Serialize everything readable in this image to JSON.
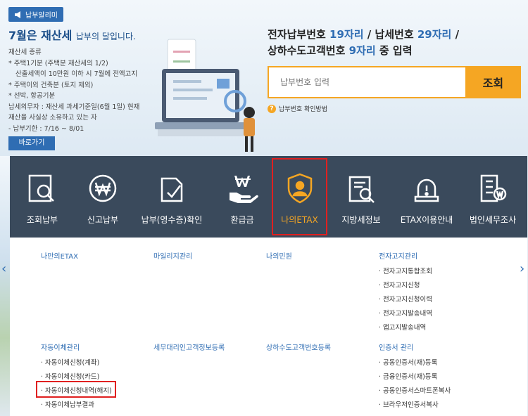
{
  "notice": {
    "badge": "납부알리미",
    "title_main": "7월은 재산세",
    "title_sub": "납부의 달입니다.",
    "lines": [
      "재산세 종류",
      "* 주택1기분 (주택분 재산세의 1/2)",
      "  산출세액이 10만원 이하 시 7월에 전액고지",
      "* 주택이외 건축분 (토지 제외)",
      "* 선박, 항공기분",
      "납세의무자 : 재산세 과세기준일(6월 1일) 현재",
      "재산을 사실상 소유하고 있는 자",
      "- 납부기한 : 7/16 ~ 8/01"
    ],
    "goto_label": "바로가기"
  },
  "payment": {
    "title_line1_a": "전자납부번호 ",
    "title_line1_b": "19자리",
    "title_line1_c": " / 납세번호 ",
    "title_line1_d": "29자리",
    "title_line1_e": " /",
    "title_line2_a": "상하수도고객번호 ",
    "title_line2_b": "9자리",
    "title_line2_c": " 중 입력",
    "input_placeholder": "납부번호 입력",
    "search_label": "조회",
    "help_icon": "?",
    "help_label": "납부번호 확인방법",
    "accent": "#f5a623"
  },
  "nav": {
    "items": [
      {
        "label": "조회납부",
        "icon": "magnifier-doc-icon"
      },
      {
        "label": "신고납부",
        "icon": "won-circle-icon"
      },
      {
        "label": "납부(영수증)확인",
        "icon": "doc-check-icon"
      },
      {
        "label": "환급금",
        "icon": "hand-won-icon"
      },
      {
        "label": "나의ETAX",
        "icon": "shield-user-icon",
        "active": true
      },
      {
        "label": "지방세정보",
        "icon": "doc-search-icon"
      },
      {
        "label": "ETAX이용안내",
        "icon": "siren-icon"
      },
      {
        "label": "법인세무조사",
        "icon": "building-won-icon"
      }
    ]
  },
  "panel": {
    "groups": [
      {
        "head": "나만의ETAX",
        "items": []
      },
      {
        "head": "마일리지관리",
        "items": []
      },
      {
        "head": "나의민원",
        "items": []
      },
      {
        "head": "전자고지관리",
        "items": [
          "· 전자고지통합조회",
          "· 전자고지신청",
          "· 전자고지신청이력",
          "· 전자고지발송내역",
          "· 앱고지발송내역"
        ]
      },
      {
        "head": "자동이체관리",
        "items": [
          "· 자동이체신청(계좌)",
          "· 자동이체신청(카드)",
          "· 자동이체신청내역(해지)",
          "· 자동이체납부결과"
        ]
      },
      {
        "head": "세무대리인고객정보등록",
        "items": []
      },
      {
        "head": "상하수도고객번호등록",
        "items": []
      },
      {
        "head": "인증서 관리",
        "items": [
          "· 공동인증서(재)등록",
          "· 금융인증서(재)등록",
          "· 공동인증서스마트폰복사",
          "· 브라우저인증서복사"
        ]
      }
    ]
  },
  "arrows": {
    "prev": "‹",
    "next": "›"
  }
}
